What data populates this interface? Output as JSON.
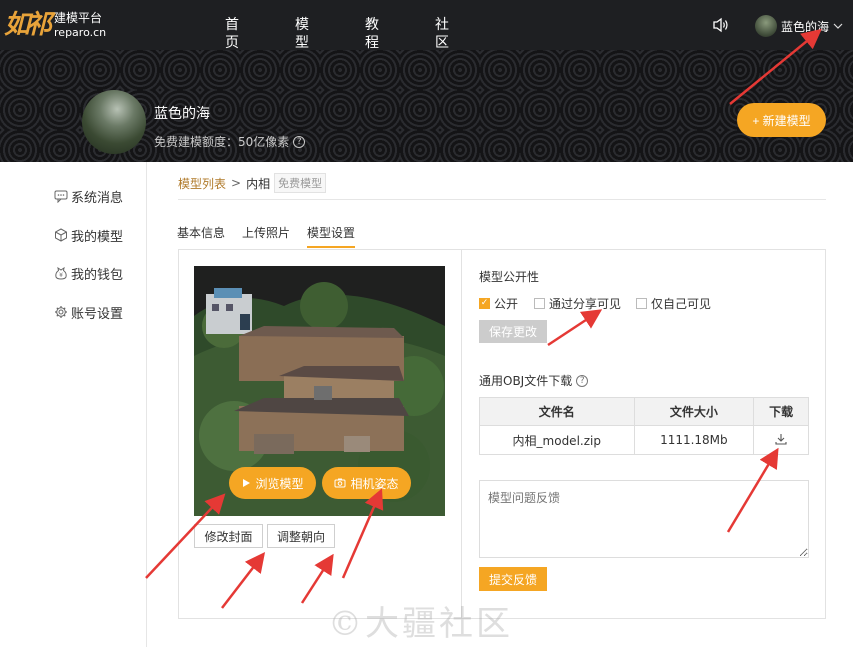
{
  "brand": {
    "logo_mark": "如祁",
    "title": "建模平台",
    "domain": "reparo.cn"
  },
  "nav": {
    "items": [
      "首页",
      "模型",
      "教程",
      "社区"
    ]
  },
  "user": {
    "name": "蓝色的海"
  },
  "profile": {
    "name": "蓝色的海",
    "quota_text": "免费建模额度：50亿像素",
    "new_model_label": "+ 新建模型"
  },
  "sidebar": {
    "items": [
      "系统消息",
      "我的模型",
      "我的钱包",
      "账号设置"
    ]
  },
  "breadcrumb": {
    "root": "模型列表",
    "separator": ">",
    "current": "内相",
    "badge": "免费模型"
  },
  "tabs": [
    "基本信息",
    "上传照片",
    "模型设置"
  ],
  "cover": {
    "browse_label": "浏览模型",
    "camera_label": "相机姿态",
    "edit_cover_label": "修改封面",
    "orient_label": "调整朝向"
  },
  "visibility": {
    "title": "模型公开性",
    "options": [
      "公开",
      "通过分享可见",
      "仅自己可见"
    ],
    "selected": "公开",
    "save_label": "保存更改"
  },
  "download": {
    "title": "通用OBJ文件下载",
    "columns": [
      "文件名",
      "文件大小",
      "下载"
    ],
    "rows": [
      {
        "name": "内相_model.zip",
        "size": "1111.18Mb"
      }
    ]
  },
  "feedback": {
    "placeholder": "模型问题反馈",
    "submit_label": "提交反馈"
  },
  "watermark": "©大疆社区",
  "colors": {
    "accent": "#f5a623",
    "topbar": "#1e1f22",
    "link": "#b07a2a"
  }
}
